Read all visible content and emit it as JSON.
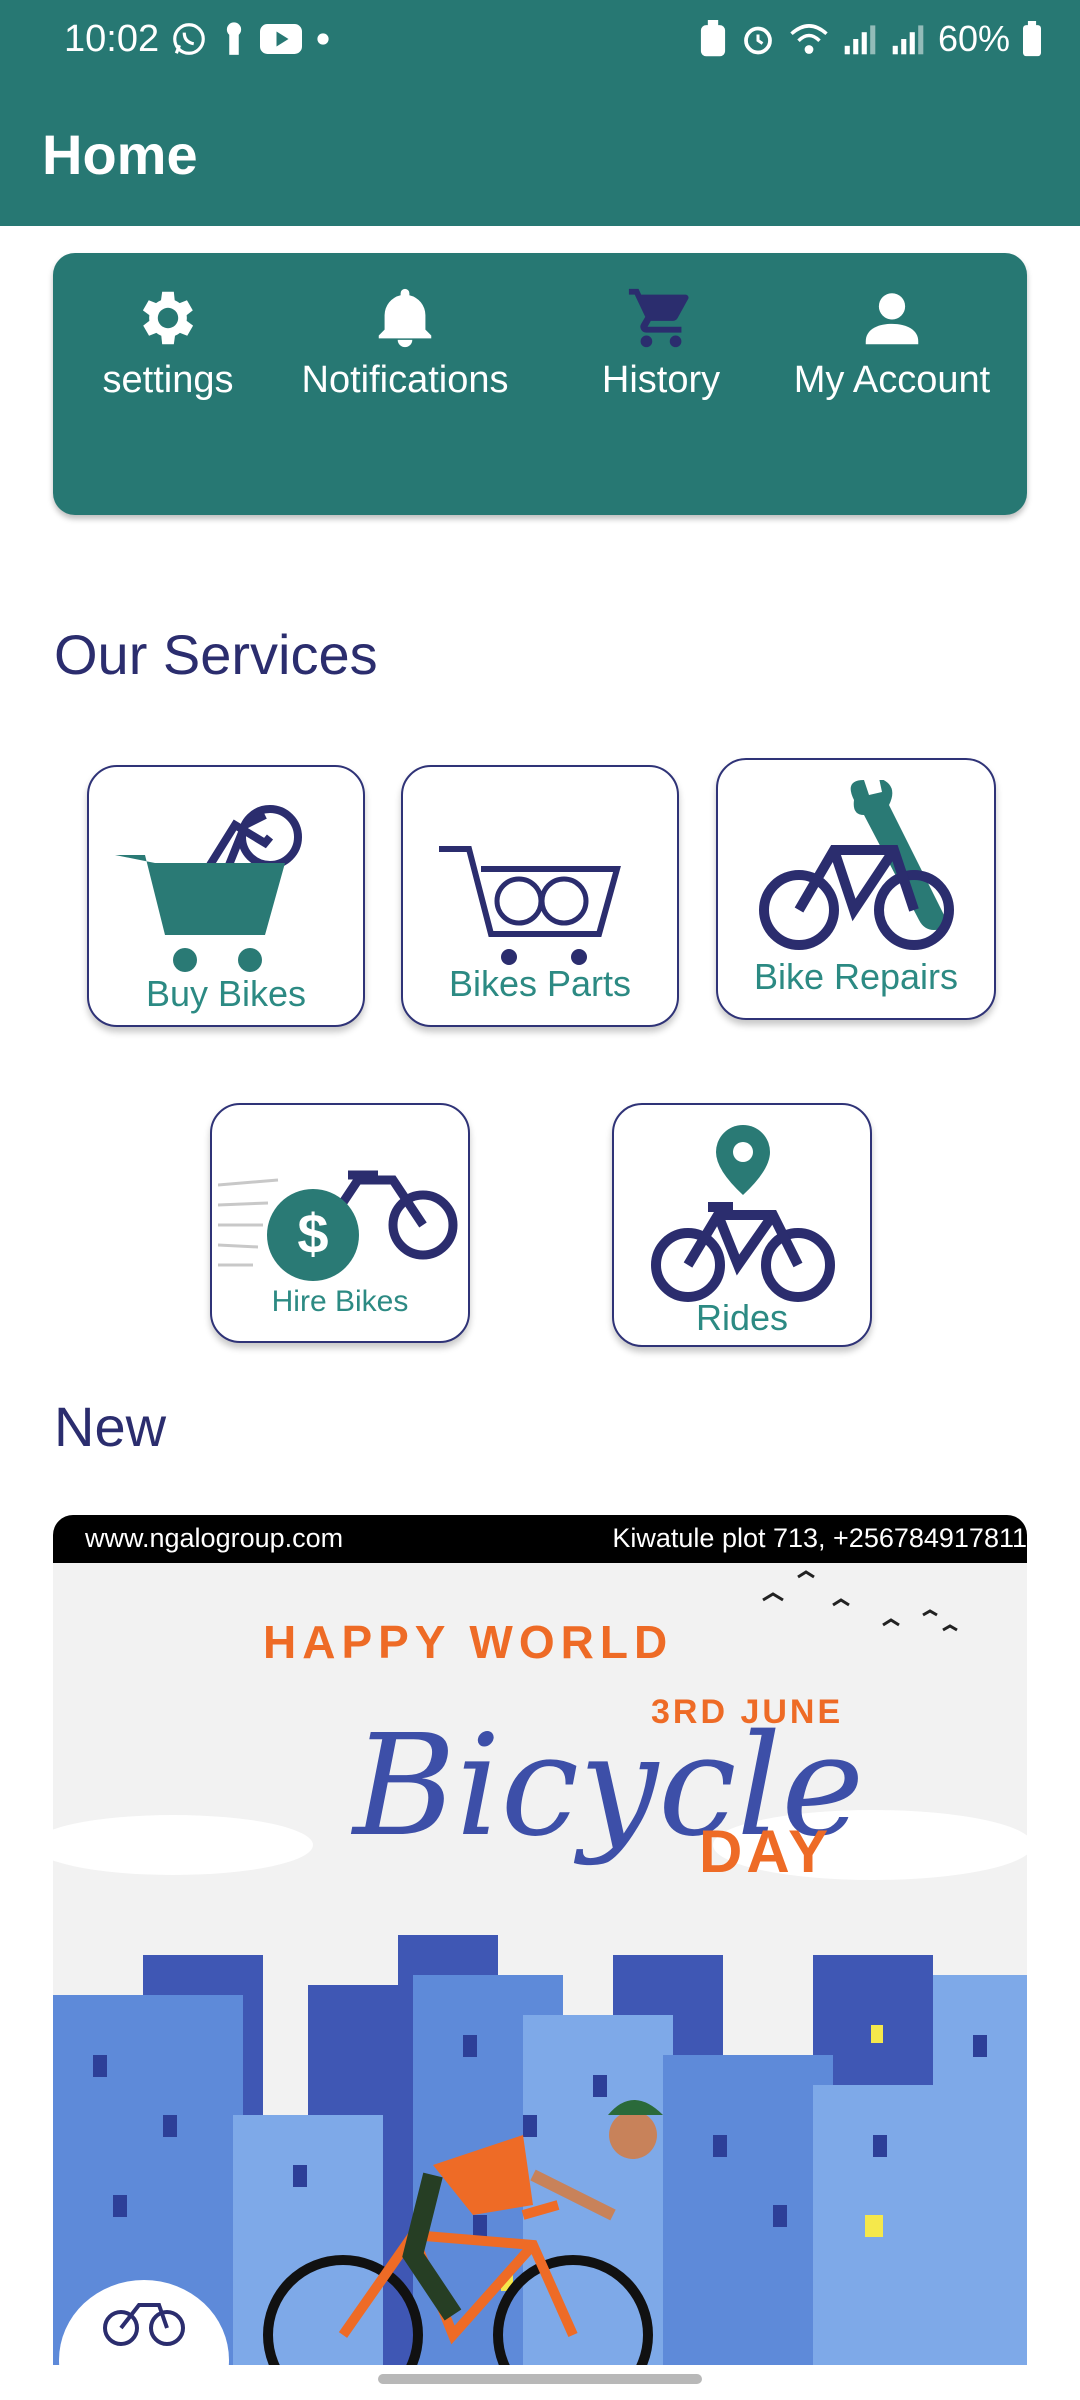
{
  "status_bar": {
    "time": "10:02",
    "battery": "60%"
  },
  "app_bar": {
    "title": "Home"
  },
  "quick_actions": [
    {
      "label": "settings",
      "icon": "gear-icon"
    },
    {
      "label": "Notifications",
      "icon": "bell-icon"
    },
    {
      "label": "History",
      "icon": "cart-icon"
    },
    {
      "label": "My Account",
      "icon": "person-icon"
    }
  ],
  "sections": {
    "services_title": "Our Services",
    "new_title": "New"
  },
  "services": [
    {
      "label": "Buy Bikes",
      "icon": "cart-bike-icon"
    },
    {
      "label": "Bikes Parts",
      "icon": "parts-cart-icon"
    },
    {
      "label": "Bike Repairs",
      "icon": "bike-wrench-icon"
    },
    {
      "label": "Hire Bikes",
      "icon": "bike-dollar-icon"
    },
    {
      "label": "Rides",
      "icon": "bike-pin-icon"
    }
  ],
  "banner": {
    "website": "www.ngalogroup.com",
    "address": "Kiwatule plot 713, +256784917811",
    "happy_world": "HAPPY WORLD",
    "date": "3RD JUNE",
    "bicycle": "Bicycle",
    "day": "DAY"
  },
  "colors": {
    "primary": "#277873",
    "navy": "#2b2d6e",
    "teal_text": "#2c8a83",
    "orange": "#ee6b26"
  }
}
